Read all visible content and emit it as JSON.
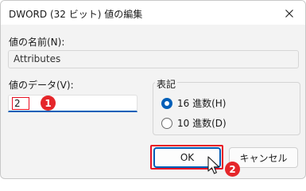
{
  "window": {
    "title": "DWORD (32 ビット) 値の編集",
    "close_glyph": "✕"
  },
  "value_name": {
    "label": "値の名前(N):",
    "value": "Attributes"
  },
  "value_data": {
    "label": "値のデータ(V):",
    "value": "2"
  },
  "base_group": {
    "title": "表記",
    "options": [
      {
        "label": "16 進数(H)",
        "selected": true
      },
      {
        "label": "10 進数(D)",
        "selected": false
      }
    ]
  },
  "buttons": {
    "ok_label": "OK",
    "cancel_label": "キャンセル"
  },
  "annotations": {
    "step1": "1",
    "step2": "2",
    "highlight_color": "#e81123",
    "badge_color": "#e5262a"
  },
  "theme": {
    "accent": "#005fb8",
    "background": "#f3f3f3"
  },
  "icons": [
    "close-icon",
    "radio-selected-icon",
    "radio-unselected-icon",
    "mouse-pointer-icon"
  ]
}
